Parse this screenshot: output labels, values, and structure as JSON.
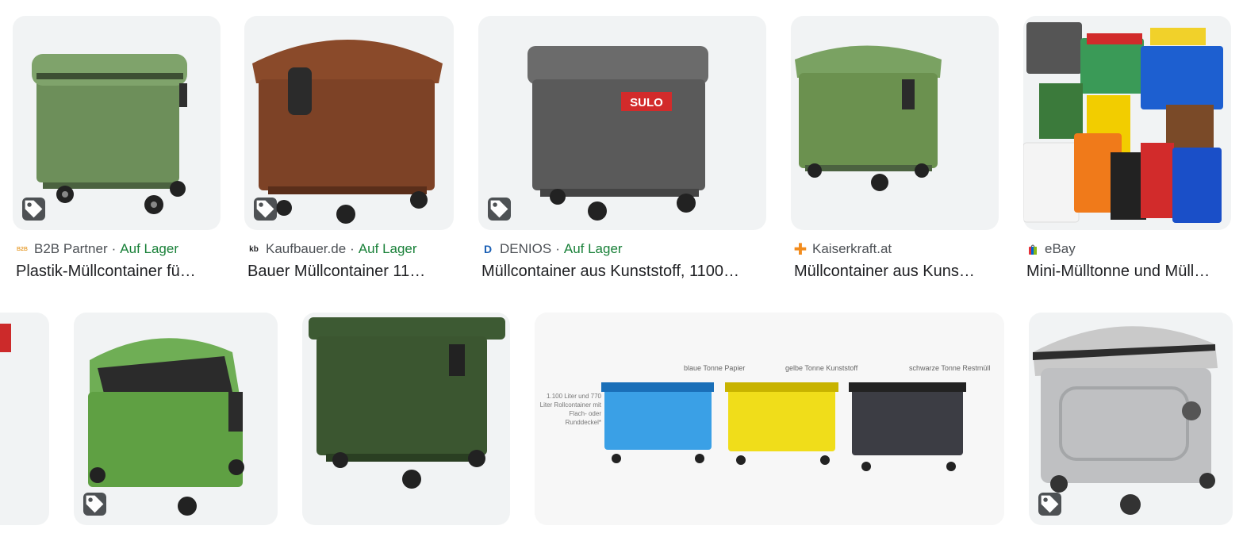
{
  "results": [
    {
      "source": "B2B Partner",
      "stock": "Auf Lager",
      "title": "Plastik-Müllcontainer fü…",
      "favicon": "b2b-favicon"
    },
    {
      "source": "Kaufbauer.de",
      "stock": "Auf Lager",
      "title": "Bauer Müllcontainer 11…",
      "favicon": "kb-favicon"
    },
    {
      "source": "DENIOS",
      "stock": "Auf Lager",
      "title": "Müllcontainer aus Kunststoff, 1100…",
      "favicon": "denios-favicon"
    },
    {
      "source": "Kaiserkraft.at",
      "stock": "",
      "title": "Müllcontainer aus Kuns…",
      "favicon": "kaiserkraft-favicon"
    },
    {
      "source": "eBay",
      "stock": "",
      "title": "Mini-Mülltonne und Müll…",
      "favicon": "ebay-favicon"
    }
  ],
  "row1_labels": {
    "sulo": "SULO"
  },
  "infographic": {
    "label_blue": "blaue Tonne Papier",
    "label_yellow": "gelbe Tonne Kunststoff",
    "label_black": "schwarze Tonne Restmüll",
    "side_text": "1.100 Liter und 770 Liter Rollcontainer mit Flach- oder Runddeckel*"
  },
  "colors": {
    "stock": "#188038",
    "thumb_bg": "#f1f3f4",
    "text": "#202124",
    "meta": "#4d5156"
  },
  "icons": {
    "tag": "shopping-tag-icon"
  }
}
